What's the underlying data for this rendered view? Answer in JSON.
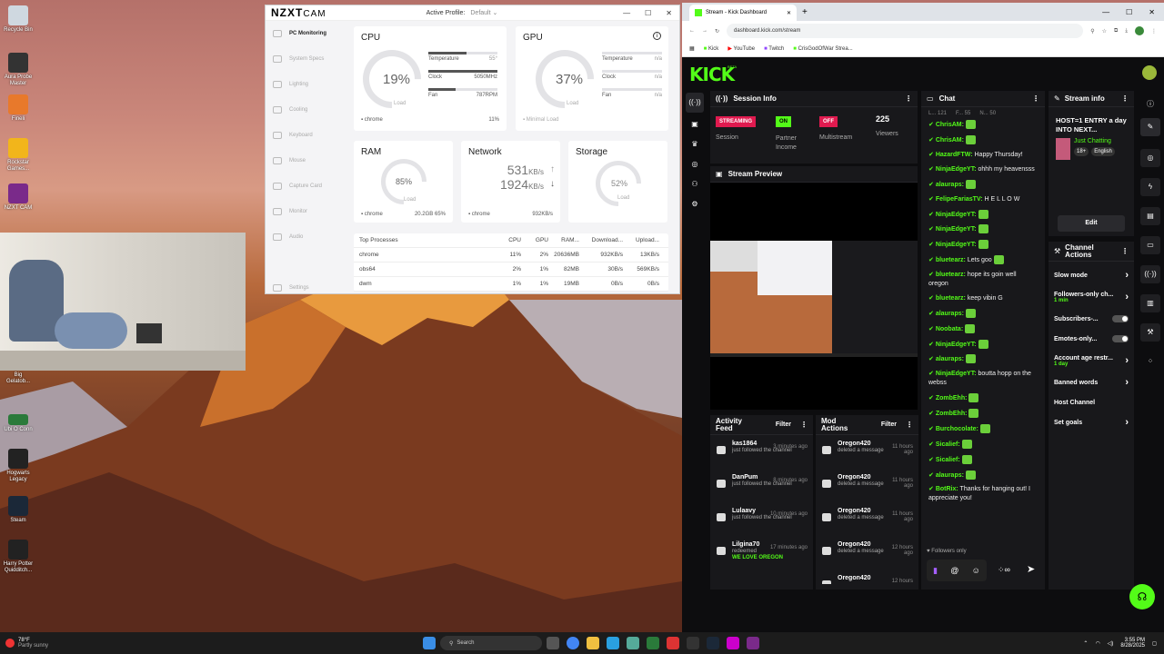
{
  "desktop_icons": [
    "Recycle Bin",
    "Aura Probe Master",
    "Fineli",
    "Rockstar Games...",
    "NZXT CAM",
    "Big Gelatob...",
    "Ubi O Conn",
    "Hogwarts Legacy",
    "Steam",
    "Harry Potter Quidditch..."
  ],
  "nzxt": {
    "logo": "NZXT",
    "logo2": "CAM",
    "profile_label": "Active Profile:",
    "profile_value": "Default",
    "nav": [
      "PC Monitoring",
      "System Specs",
      "Lighting",
      "Cooling",
      "Keyboard",
      "Mouse",
      "Capture Card",
      "Monitor",
      "Audio",
      "Settings"
    ],
    "cpu": {
      "title": "CPU",
      "pct": "19%",
      "load": "Load",
      "temp_l": "Temperature",
      "temp_v": "55°",
      "clock_l": "Clock",
      "clock_v": "5050MHz",
      "fan_l": "Fan",
      "fan_v": "787RPM",
      "proc": "chrome",
      "proc_pct": "11%",
      "pct_num": 19
    },
    "gpu": {
      "title": "GPU",
      "pct": "37%",
      "load": "Load",
      "temp_l": "Temperature",
      "temp_v": "n/a",
      "clock_l": "Clock",
      "clock_v": "n/a",
      "fan_l": "Fan",
      "fan_v": "n/a",
      "proc": "Minimal Load",
      "pct_num": 37
    },
    "ram": {
      "title": "RAM",
      "pct": "85%",
      "load": "Load",
      "proc": "chrome",
      "used": "20.2GB",
      "used_pct": "65%",
      "pct_num": 85
    },
    "net": {
      "title": "Network",
      "down": "531",
      "up": "1924",
      "unit": "KB/s",
      "proc": "chrome",
      "proc_v": "932KB/s"
    },
    "storage": {
      "title": "Storage",
      "pct": "52%",
      "load": "Load",
      "pct_num": 52
    },
    "proc_table": {
      "headers": [
        "Top Processes",
        "CPU",
        "GPU",
        "RAM...",
        "Download...",
        "Upload..."
      ],
      "rows": [
        [
          "chrome",
          "11%",
          "2%",
          "20636MB",
          "932KB/s",
          "13KB/s"
        ],
        [
          "obs64",
          "2%",
          "1%",
          "82MB",
          "30B/s",
          "569KB/s"
        ],
        [
          "dwm",
          "1%",
          "1%",
          "19MB",
          "0B/s",
          "0B/s"
        ]
      ]
    }
  },
  "browser": {
    "tab1": "Stream - Kick Dashboard",
    "url": "dashboard.kick.com/stream",
    "bookmarks": [
      "Kick",
      "YouTube",
      "Twitch",
      "CrisGodOfWar Strea..."
    ],
    "logo": "KICK",
    "beta": "BETA",
    "session": {
      "title": "Session Info",
      "streaming": "STREAMING",
      "streaming_l": "Session",
      "on": "ON",
      "partner_l": "Partner Income",
      "off": "OFF",
      "multi_l": "Multistream",
      "viewers": "225",
      "viewers_l": "Viewers"
    },
    "preview": "Stream Preview",
    "activity": {
      "title": "Activity Feed",
      "filter": "Filter",
      "items": [
        {
          "name": "kas1864",
          "time": "3 minutes ago",
          "text": "just followed the channel"
        },
        {
          "name": "DanPum",
          "time": "8 minutes ago",
          "text": "just followed the channel"
        },
        {
          "name": "Lulaavy",
          "time": "10 minutes ago",
          "text": "just followed the channel"
        },
        {
          "name": "Lilgina70",
          "time": "17 minutes ago",
          "text": "redeemed",
          "extra": "WE LOVE OREGON"
        }
      ]
    },
    "mod": {
      "title": "Mod Actions",
      "filter": "Filter",
      "items": [
        {
          "name": "Oregon420",
          "time": "11 hours ago",
          "text": "deleted a message"
        },
        {
          "name": "Oregon420",
          "time": "11 hours ago",
          "text": "deleted a message"
        },
        {
          "name": "Oregon420",
          "time": "11 hours ago",
          "text": "deleted a message"
        },
        {
          "name": "Oregon420",
          "time": "12 hours ago",
          "text": "deleted a message"
        },
        {
          "name": "Oregon420",
          "time": "12 hours ago",
          "text": ""
        }
      ]
    },
    "chat": {
      "title": "Chat",
      "tabs": [
        "L... 121",
        "F... 55",
        "N... 50"
      ],
      "mode": "Followers only",
      "lines": [
        {
          "u": "ChrisAM:",
          "m": ""
        },
        {
          "u": "ChrisAM:",
          "m": ""
        },
        {
          "u": "HazardFTW:",
          "m": "Happy Thursday!"
        },
        {
          "u": "NinjaEdgeYT:",
          "m": "ohhh my heavensss"
        },
        {
          "u": "alauraps:",
          "m": ""
        },
        {
          "u": "FelipeFariasTV:",
          "m": "H E L L O W"
        },
        {
          "u": "NinjaEdgeYT:",
          "m": ""
        },
        {
          "u": "NinjaEdgeYT:",
          "m": ""
        },
        {
          "u": "NinjaEdgeYT:",
          "m": ""
        },
        {
          "u": "bluetearz:",
          "m": "Lets goo"
        },
        {
          "u": "bluetearz:",
          "m": "hope its goin well oregon"
        },
        {
          "u": "bluetearz:",
          "m": "keep vibin G"
        },
        {
          "u": "alauraps:",
          "m": ""
        },
        {
          "u": "Noobata:",
          "m": ""
        },
        {
          "u": "NinjaEdgeYT:",
          "m": ""
        },
        {
          "u": "alauraps:",
          "m": ""
        },
        {
          "u": "NinjaEdgeYT:",
          "m": "boutta hopp on the webss"
        },
        {
          "u": "ZombEhh:",
          "m": ""
        },
        {
          "u": "ZombEhh:",
          "m": ""
        },
        {
          "u": "Burchocolate:",
          "m": ""
        },
        {
          "u": "Sicalief:",
          "m": ""
        },
        {
          "u": "Sicalief:",
          "m": ""
        },
        {
          "u": "alauraps:",
          "m": ""
        },
        {
          "u": "BotRix:",
          "m": "Thanks for hanging out! I appreciate you!"
        }
      ]
    },
    "stream_info": {
      "title": "Stream info",
      "stream_title": "HOST=1 ENTRY a day INTO NEXT...",
      "category": "Just Chatting",
      "tags": [
        "18+",
        "English"
      ],
      "edit": "Edit"
    },
    "channel_actions": {
      "title": "Channel Actions",
      "items": [
        {
          "label": "Slow mode",
          "type": "arrow"
        },
        {
          "label": "Followers-only ch...",
          "sub": "1 min",
          "type": "arrow"
        },
        {
          "label": "Subscribers-...",
          "type": "toggle"
        },
        {
          "label": "Emotes-only...",
          "type": "toggle"
        },
        {
          "label": "Account age restr...",
          "sub": "1 day",
          "type": "arrow"
        },
        {
          "label": "Banned words",
          "type": "arrow"
        },
        {
          "label": "Host Channel",
          "type": "none"
        },
        {
          "label": "Set goals",
          "type": "arrow"
        }
      ]
    }
  },
  "taskbar": {
    "weather_t": "78°F",
    "weather_d": "Partly sunny",
    "search": "Search",
    "time": "3:55 PM",
    "date": "8/28/2025"
  },
  "colors": {
    "kick_green": "#53fc18",
    "streaming_red": "#e01a4f"
  }
}
